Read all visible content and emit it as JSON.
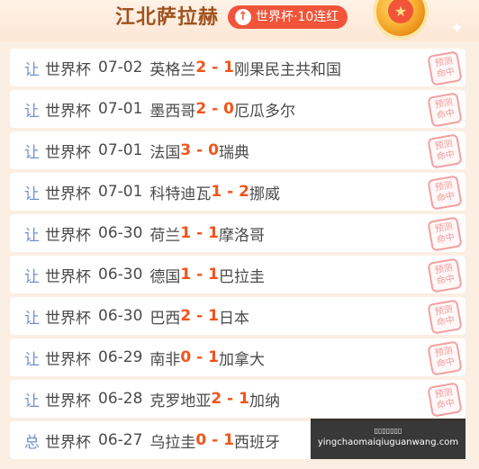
{
  "header": {
    "expert_name": "江北萨拉赫",
    "streak_label": "世界杯·10连红",
    "streak_icon": "arrow-up-icon",
    "medal_icon": "star-medal-icon"
  },
  "stamp": {
    "line1": "预测",
    "line2": "命中"
  },
  "matches": [
    {
      "tag": "让",
      "league": "世界杯",
      "date": "07-02",
      "home": "英格兰",
      "home_score": "2",
      "sep": " - ",
      "away_score": "1",
      "away": "刚果民主共和国"
    },
    {
      "tag": "让",
      "league": "世界杯",
      "date": "07-01",
      "home": "墨西哥",
      "home_score": "2",
      "sep": " - ",
      "away_score": "0",
      "away": "厄瓜多尔"
    },
    {
      "tag": "让",
      "league": "世界杯",
      "date": "07-01",
      "home": "法国",
      "home_score": "3",
      "sep": " - ",
      "away_score": "0",
      "away": "瑞典"
    },
    {
      "tag": "让",
      "league": "世界杯",
      "date": "07-01",
      "home": "科特迪瓦",
      "home_score": "1",
      "sep": " - ",
      "away_score": "2",
      "away": "挪威"
    },
    {
      "tag": "让",
      "league": "世界杯",
      "date": "06-30",
      "home": "荷兰",
      "home_score": "1",
      "sep": " - ",
      "away_score": "1",
      "away": "摩洛哥"
    },
    {
      "tag": "让",
      "league": "世界杯",
      "date": "06-30",
      "home": "德国",
      "home_score": "1",
      "sep": " - ",
      "away_score": "1",
      "away": "巴拉圭"
    },
    {
      "tag": "让",
      "league": "世界杯",
      "date": "06-30",
      "home": "巴西",
      "home_score": "2",
      "sep": " - ",
      "away_score": "1",
      "away": "日本"
    },
    {
      "tag": "让",
      "league": "世界杯",
      "date": "06-29",
      "home": "南非",
      "home_score": "0",
      "sep": " - ",
      "away_score": "1",
      "away": "加拿大"
    },
    {
      "tag": "让",
      "league": "世界杯",
      "date": "06-28",
      "home": "克罗地亚",
      "home_score": "2",
      "sep": " - ",
      "away_score": "1",
      "away": "加纳"
    },
    {
      "tag": "总",
      "league": "世界杯",
      "date": "06-27",
      "home": "乌拉圭",
      "home_score": "0",
      "sep": " - ",
      "away_score": "1",
      "away": "西班牙"
    }
  ],
  "watermark": {
    "title": "▯▯▯▯▯▯▯",
    "url": "yingchaomaiqiuguanwang.com"
  }
}
